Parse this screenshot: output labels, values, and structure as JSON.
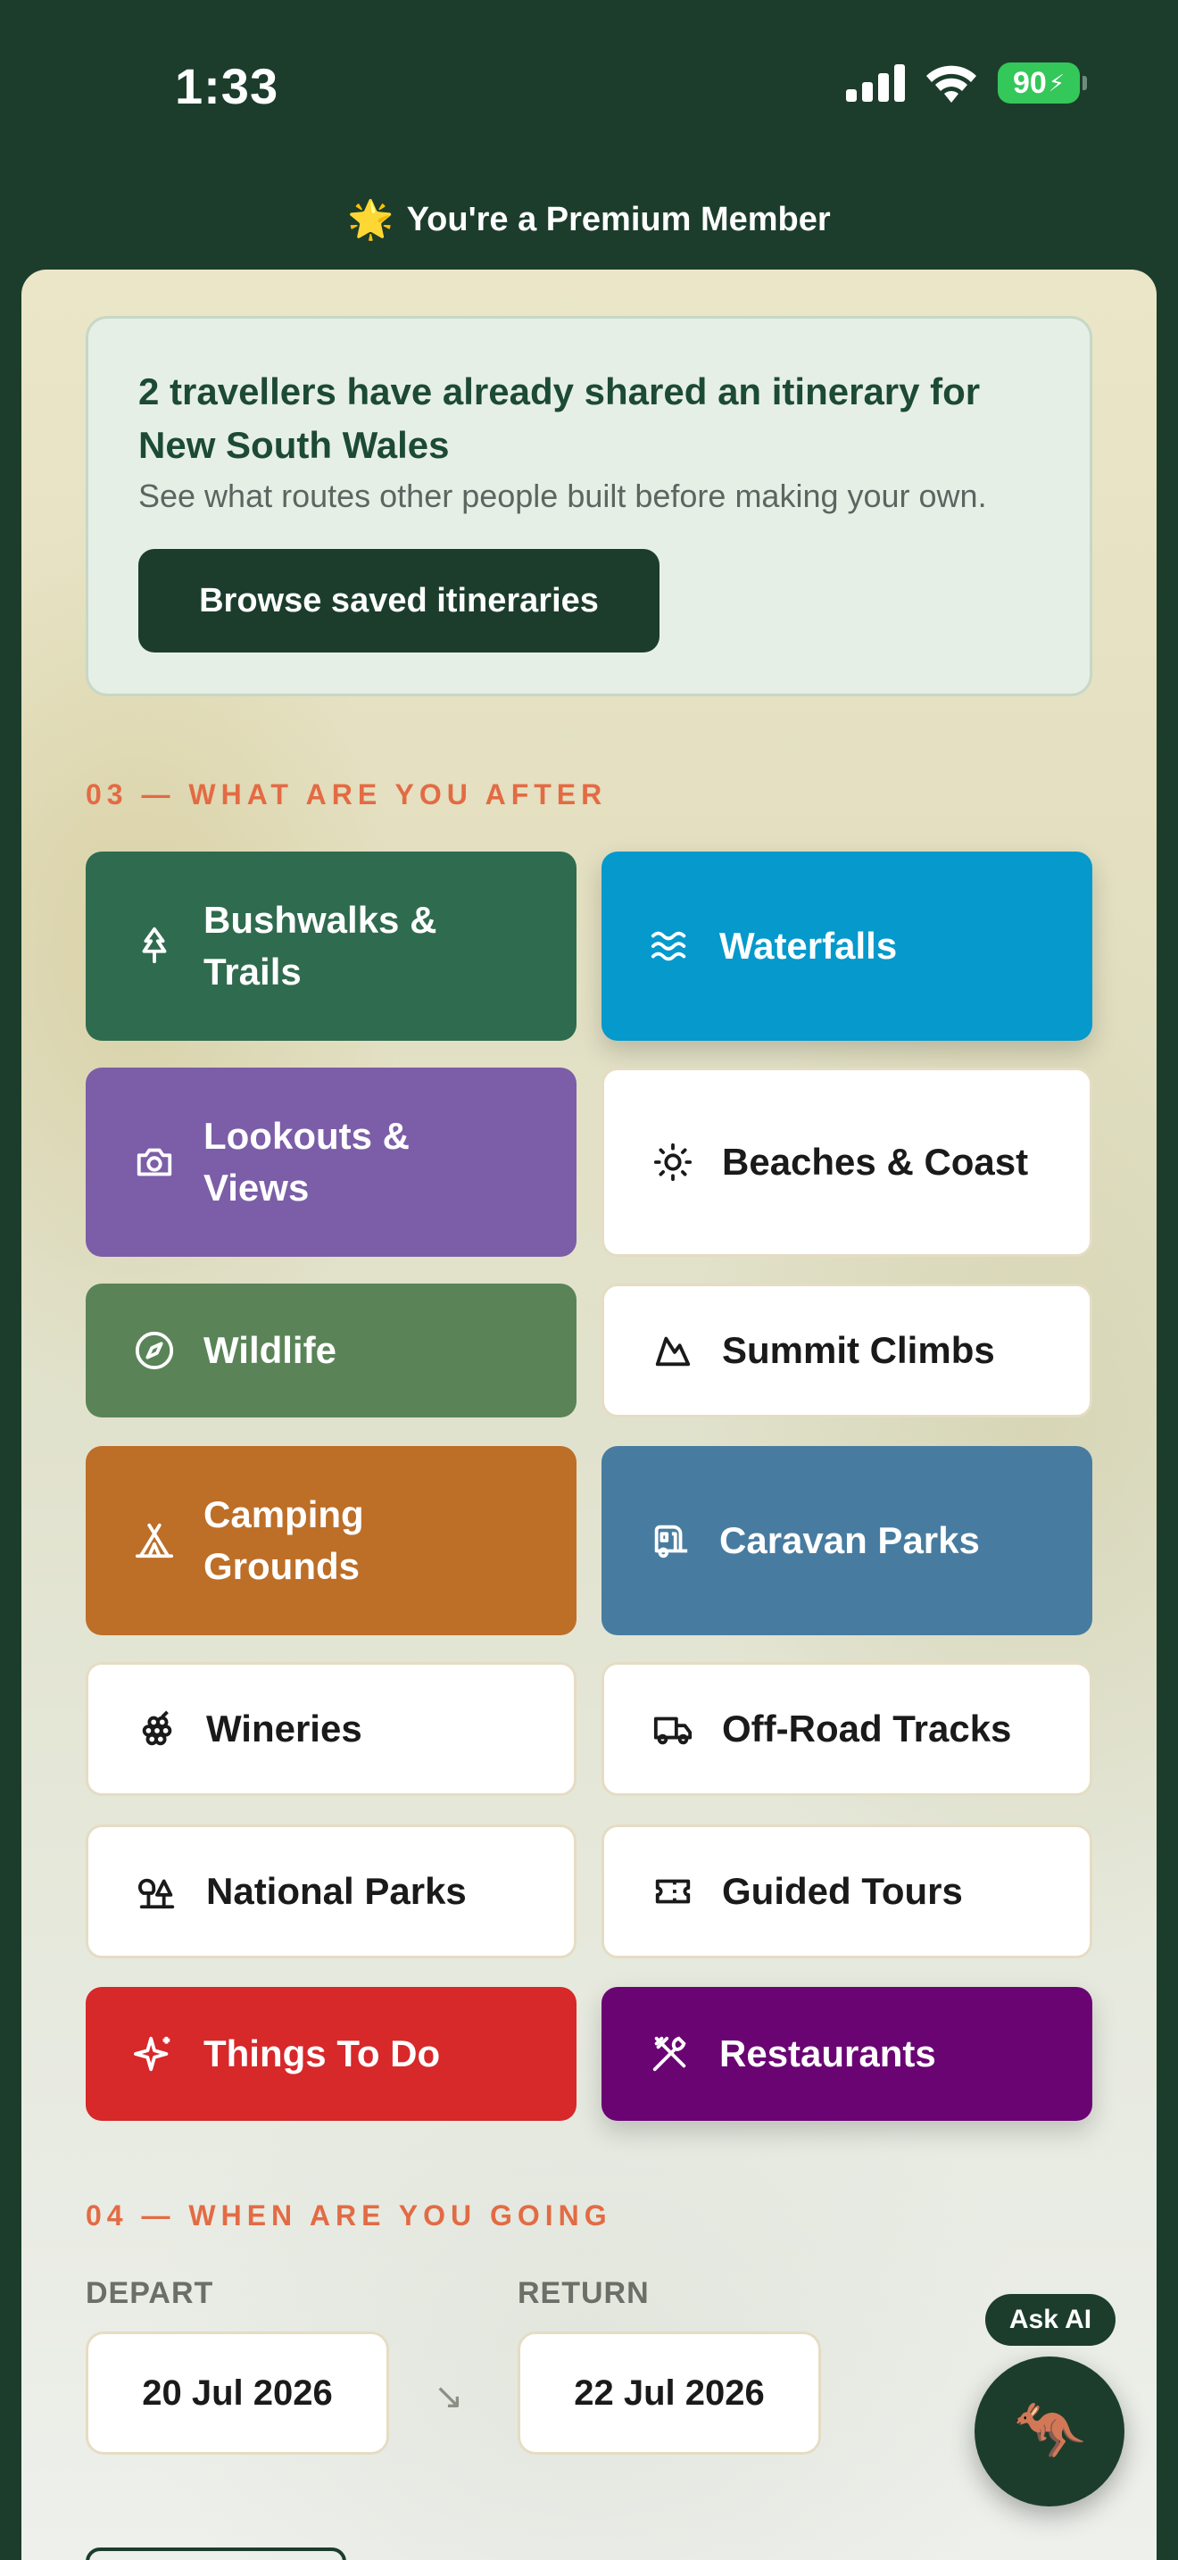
{
  "status_bar": {
    "time": "1:33",
    "battery": "90"
  },
  "banner": {
    "star": "🌟",
    "text": "You're a Premium Member"
  },
  "share_card": {
    "title": "2 travellers have already shared an itinerary for New South Wales",
    "subtitle": "See what routes other people built before making your own.",
    "button": "Browse saved itineraries"
  },
  "section_after": {
    "label": "03 — WHAT ARE YOU AFTER"
  },
  "tiles": [
    {
      "label": "Bushwalks & Trails",
      "icon": "tree-icon",
      "color": "#2f6b4f",
      "selected": true
    },
    {
      "label": "Waterfalls",
      "icon": "waves-icon",
      "color": "#0599cc",
      "selected": true
    },
    {
      "label": "Lookouts & Views",
      "icon": "camera-icon",
      "color": "#7b5ea7",
      "selected": true
    },
    {
      "label": "Beaches & Coast",
      "icon": "sun-icon",
      "color": "#ffffff",
      "selected": false
    },
    {
      "label": "Wildlife",
      "icon": "compass-icon",
      "color": "#5a8457",
      "selected": true
    },
    {
      "label": "Summit Climbs",
      "icon": "mountain-icon",
      "color": "#ffffff",
      "selected": false
    },
    {
      "label": "Camping Grounds",
      "icon": "tent-icon",
      "color": "#bd6e27",
      "selected": true
    },
    {
      "label": "Caravan Parks",
      "icon": "caravan-icon",
      "color": "#477ca0",
      "selected": true
    },
    {
      "label": "Wineries",
      "icon": "grapes-icon",
      "color": "#ffffff",
      "selected": false
    },
    {
      "label": "Off-Road Tracks",
      "icon": "truck-icon",
      "color": "#ffffff",
      "selected": false
    },
    {
      "label": "National Parks",
      "icon": "trees-icon",
      "color": "#ffffff",
      "selected": false
    },
    {
      "label": "Guided Tours",
      "icon": "ticket-icon",
      "color": "#ffffff",
      "selected": false
    },
    {
      "label": "Things To Do",
      "icon": "sparkle-icon",
      "color": "#d7282a",
      "selected": true
    },
    {
      "label": "Restaurants",
      "icon": "utensils-icon",
      "color": "#6a0473",
      "selected": true
    }
  ],
  "section_when": {
    "label": "04 — WHEN ARE YOU GOING"
  },
  "dates": {
    "depart_label": "DEPART",
    "depart_value": "20 Jul 2026",
    "return_label": "RETURN",
    "return_value": "22 Jul 2026",
    "arrow": "↘"
  },
  "ask_ai": {
    "label": "Ask AI",
    "mascot": "🦘"
  }
}
